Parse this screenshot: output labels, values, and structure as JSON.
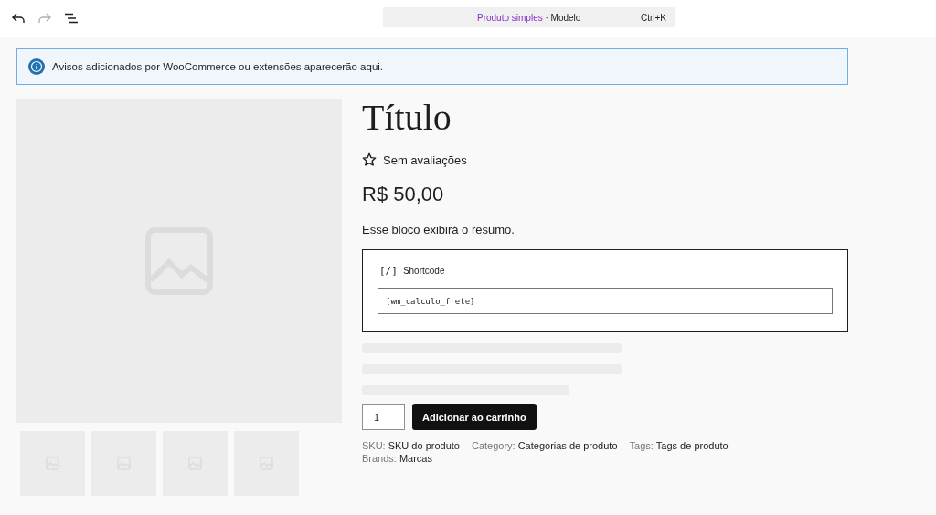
{
  "toolbar": {
    "doc_type": "Produto simples",
    "separator": "·",
    "doc_name": "Modelo",
    "shortcut": "Ctrl+K"
  },
  "notice": {
    "text": "Avisos adicionados por WooCommerce ou extensões aparecerão aqui."
  },
  "product": {
    "title": "Título",
    "rating_text": "Sem avaliações",
    "price": "R$ 50,00",
    "excerpt": "Esse bloco exibirá o resumo.",
    "shortcode": {
      "label": "Shortcode",
      "icon_text": "[/]",
      "value": "[wm_calculo_frete]"
    },
    "quantity": "1",
    "add_to_cart": "Adicionar ao carrinho",
    "meta": [
      {
        "label": "SKU:",
        "value": "SKU do produto"
      },
      {
        "label": "Category:",
        "value": "Categorias de produto"
      },
      {
        "label": "Tags:",
        "value": "Tags de produto"
      },
      {
        "label": "Brands:",
        "value": "Marcas"
      }
    ]
  }
}
